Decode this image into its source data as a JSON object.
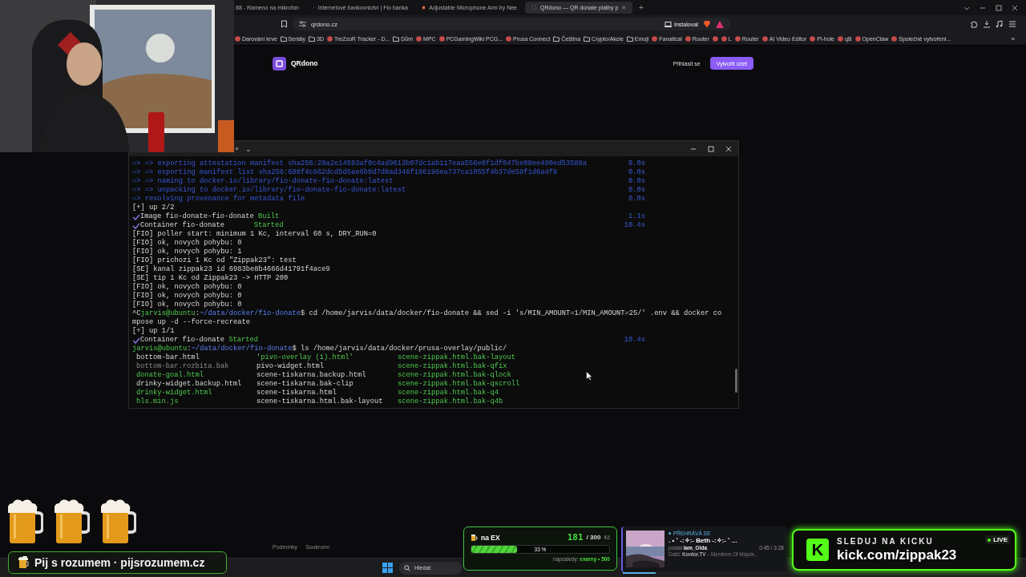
{
  "browser": {
    "tabs": [
      {
        "title": "88 - Rameno na mikrofon",
        "selected": false
      },
      {
        "title": "Internetové bankovnictví | Fio banka",
        "selected": false
      },
      {
        "title": "Adjustable Microphone Arm by Nee",
        "selected": false
      },
      {
        "title": "QRdono — QR donate platby p",
        "selected": true
      }
    ],
    "new_tab": "+",
    "address": "qrdono.cz",
    "install": "Instalovat",
    "bookmarks": [
      {
        "label": "Darování krve",
        "kind": "site"
      },
      {
        "label": "Seriály",
        "kind": "folder"
      },
      {
        "label": "3D",
        "kind": "folder"
      },
      {
        "label": "TreZzoR Tracker - D...",
        "kind": "site"
      },
      {
        "label": "Dům",
        "kind": "folder"
      },
      {
        "label": "MPC",
        "kind": "site"
      },
      {
        "label": "PCGamingWiki PCG...",
        "kind": "site"
      },
      {
        "label": "Prusa Connect",
        "kind": "site"
      },
      {
        "label": "Čeština",
        "kind": "folder"
      },
      {
        "label": "Crypto/Akcie",
        "kind": "folder"
      },
      {
        "label": "Emoji",
        "kind": "folder"
      },
      {
        "label": "Fanatical",
        "kind": "site"
      },
      {
        "label": "Router",
        "kind": "site"
      },
      {
        "kind": "site"
      },
      {
        "label": "L",
        "kind": "site"
      },
      {
        "label": "Router",
        "kind": "site"
      },
      {
        "label": "AI Video Editor",
        "kind": "site"
      },
      {
        "label": "Pi-hole",
        "kind": "site"
      },
      {
        "label": "qB",
        "kind": "site"
      },
      {
        "label": "OpenClaw",
        "kind": "site"
      },
      {
        "label": "Společné vytvoření...",
        "kind": "site"
      }
    ],
    "more": "»"
  },
  "page": {
    "logo": "QRdono",
    "login": "Přihlásit se",
    "signup": "Vytvořit účet",
    "footer_links": [
      "Podmínky",
      "Soukromí"
    ]
  },
  "terminal": {
    "controls": [
      "+",
      "⌄"
    ],
    "lines": [
      {
        "segments": [
          {
            "text": "=> => exporting attestation manifest sha256:29a2e14593af0c4ad9613b07dc1ab117eaa556e0f1df047be08ee480ed53588a",
            "kind": "build"
          }
        ],
        "time": "0.0s"
      },
      {
        "segments": [
          {
            "text": "=> => exporting manifest list sha256:688f4c662dcd5d5ae6b9d7d8ad346f186198ea737ca1055f4b37de59f1d6a4f8",
            "kind": "build"
          }
        ],
        "time": "0.0s"
      },
      {
        "segments": [
          {
            "text": "=> => naming to docker.io/library/fio-donate-fio-donate:latest",
            "kind": "build"
          }
        ],
        "time": "0.0s"
      },
      {
        "segments": [
          {
            "text": "=> => unpacking to docker.io/library/fio-donate-fio-donate:latest",
            "kind": "build"
          }
        ],
        "time": "0.0s"
      },
      {
        "segments": [
          {
            "text": "=> resolving provenance for metadata file",
            "kind": "build"
          }
        ],
        "time": "0.0s"
      },
      {
        "segments": [
          {
            "text": "[+] up 2/2",
            "kind": "plain"
          }
        ]
      },
      {
        "check": true,
        "segments": [
          {
            "text": "Image fio-donate-fio-donate ",
            "kind": "plain"
          },
          {
            "text": "Built",
            "kind": "ok"
          }
        ],
        "time": "1.1s"
      },
      {
        "check": true,
        "segments": [
          {
            "text": "Container fio-donate       ",
            "kind": "plain"
          },
          {
            "text": "Started",
            "kind": "ok"
          }
        ],
        "time": "10.4s"
      },
      {
        "segments": [
          {
            "text": "[FIO] poller start: minimum 1 Kc, interval 60 s, DRY_RUN=0",
            "kind": "plain"
          }
        ]
      },
      {
        "segments": [
          {
            "text": "[FIO] ok, novych pohybu: 0",
            "kind": "plain"
          }
        ]
      },
      {
        "segments": [
          {
            "text": "[FIO] ok, novych pohybu: 1",
            "kind": "plain"
          }
        ]
      },
      {
        "segments": [
          {
            "text": "[FIO] prichozi 1 Kc od \"Zippak23\": test",
            "kind": "plain"
          }
        ]
      },
      {
        "segments": [
          {
            "text": "[SE] kanal zippak23 id 6983be8b4666d41791f4ace9",
            "kind": "plain"
          }
        ]
      },
      {
        "segments": [
          {
            "text": "[SE] tip 1 Kc od Zippak23 -> HTTP 200",
            "kind": "plain"
          }
        ]
      },
      {
        "segments": [
          {
            "text": "[FIO] ok, novych pohybu: 0",
            "kind": "plain"
          }
        ]
      },
      {
        "segments": [
          {
            "text": "[FIO] ok, novych pohybu: 0",
            "kind": "plain"
          }
        ]
      },
      {
        "segments": [
          {
            "text": "[FIO] ok, novych pohybu: 0",
            "kind": "plain"
          }
        ]
      },
      {
        "segments": [
          {
            "text": "^C",
            "kind": "plain"
          },
          {
            "text": "jarvis@ubuntu",
            "kind": "user"
          },
          {
            "text": ":",
            "kind": "plain"
          },
          {
            "text": "~/data/docker/fio-donate",
            "kind": "path"
          },
          {
            "text": "$ cd /home/jarvis/data/docker/fio-donate && sed -i 's/MIN_AMOUNT=1/MIN_AMOUNT=25/' .env && docker co",
            "kind": "plain"
          }
        ]
      },
      {
        "segments": [
          {
            "text": "mpose up -d --force-recreate",
            "kind": "plain"
          }
        ]
      },
      {
        "segments": [
          {
            "text": "[+] up 1/1",
            "kind": "plain"
          }
        ]
      },
      {
        "check": true,
        "segments": [
          {
            "text": "Container fio-donate ",
            "kind": "plain"
          },
          {
            "text": "Started",
            "kind": "ok"
          }
        ],
        "time": "10.4s"
      },
      {
        "segments": [
          {
            "text": "jarvis@ubuntu",
            "kind": "user"
          },
          {
            "text": ":",
            "kind": "plain"
          },
          {
            "text": "~/data/docker/fio-donate",
            "kind": "path"
          },
          {
            "text": "$ ls /home/jarvis/data/docker/prusa-overlay/public/",
            "kind": "plain"
          }
        ]
      }
    ],
    "listing": [
      [
        {
          "name": "bottom-bar.html",
          "kind": "file"
        },
        {
          "name": "'pivo-overlay (1).html'",
          "kind": "green"
        },
        {
          "name": "scene-zippak.html.bak-layout",
          "kind": "green"
        }
      ],
      [
        {
          "name": "bottom-bar.rozbita.bak",
          "kind": "dim"
        },
        {
          "name": "pivo-widget.html",
          "kind": "file"
        },
        {
          "name": "scene-zippak.html.bak-qfix",
          "kind": "green"
        }
      ],
      [
        {
          "name": "donate-goal.html",
          "kind": "green"
        },
        {
          "name": "scene-tiskarna.backup.html",
          "kind": "file"
        },
        {
          "name": "scene-zippak.html.bak-qlock",
          "kind": "green"
        }
      ],
      [
        {
          "name": "drinky-widget.backup.html",
          "kind": "file"
        },
        {
          "name": "scene-tiskarna.bak-clip",
          "kind": "file"
        },
        {
          "name": "scene-zippak.html.bak-qscroll",
          "kind": "green"
        }
      ],
      [
        {
          "name": "drinky-widget.html",
          "kind": "green"
        },
        {
          "name": "scene-tiskarna.html",
          "kind": "file"
        },
        {
          "name": "scene-zippak.html.bak-q4",
          "kind": "green"
        }
      ],
      [
        {
          "name": "hls.min.js",
          "kind": "green"
        },
        {
          "name": "scene-tiskarna.html.bak-layout",
          "kind": "file"
        },
        {
          "name": "scene-zippak.html.bak-q4b",
          "kind": "green"
        }
      ]
    ]
  },
  "taskbar": {
    "search_placeholder": "Hledat"
  },
  "banner": {
    "text": "Pij s rozumem · pijsrozumem.cz"
  },
  "goal": {
    "title": "na EX",
    "current": "181",
    "target": "/ 300",
    "currency": "Kč",
    "level": 0.33,
    "percent": "33 %",
    "last": "naposledy: **exarny • 500**"
  },
  "now_playing": {
    "status": "PŘEHRÁVÁ SE",
    "track": ". • ˚ -:✧:- Beth -:✧:- ˚ ...",
    "sent_by": "poslal **Iam_Olda**",
    "time": "0:45 / 3:28",
    "next": "Další: **Kontor.TV** – Members Of Mayde...",
    "level": 0.2
  },
  "kick": {
    "logo": "K",
    "cta": "SLEDUJ NA KICKU",
    "url": "kick.com/zippak23",
    "live": "LIVE"
  }
}
